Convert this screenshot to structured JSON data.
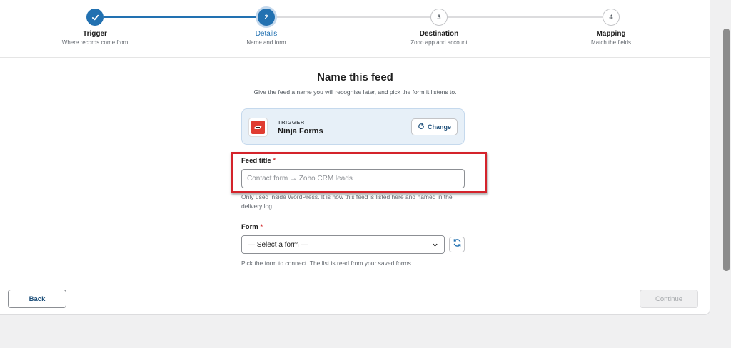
{
  "stepper": {
    "steps": [
      {
        "number": "1",
        "title": "Trigger",
        "subtitle": "Where records come from",
        "state": "done"
      },
      {
        "number": "2",
        "title": "Details",
        "subtitle": "Name and form",
        "state": "active"
      },
      {
        "number": "3",
        "title": "Destination",
        "subtitle": "Zoho app and account",
        "state": "todo"
      },
      {
        "number": "4",
        "title": "Mapping",
        "subtitle": "Match the fields",
        "state": "todo"
      }
    ]
  },
  "main": {
    "title": "Name this feed",
    "subtitle": "Give the feed a name you will recognise later, and pick the form it listens to."
  },
  "trigger_card": {
    "label": "TRIGGER",
    "name": "Ninja Forms",
    "change_label": "Change"
  },
  "feed_title": {
    "label": "Feed title",
    "required_mark": "*",
    "placeholder": "Contact form → Zoho CRM leads",
    "value": "",
    "help_line1": "Only used inside WordPress. It is how this feed is listed here and named in the",
    "help_line2": "delivery log."
  },
  "form_select": {
    "label": "Form",
    "required_mark": "*",
    "selected": "— Select a form —",
    "help": "Pick the form to connect. The list is read from your saved forms."
  },
  "footer": {
    "back_label": "Back",
    "continue_label": "Continue"
  },
  "colors": {
    "accent": "#2271b1",
    "highlight": "#d4232b",
    "brand_ninja": "#e03c31"
  }
}
